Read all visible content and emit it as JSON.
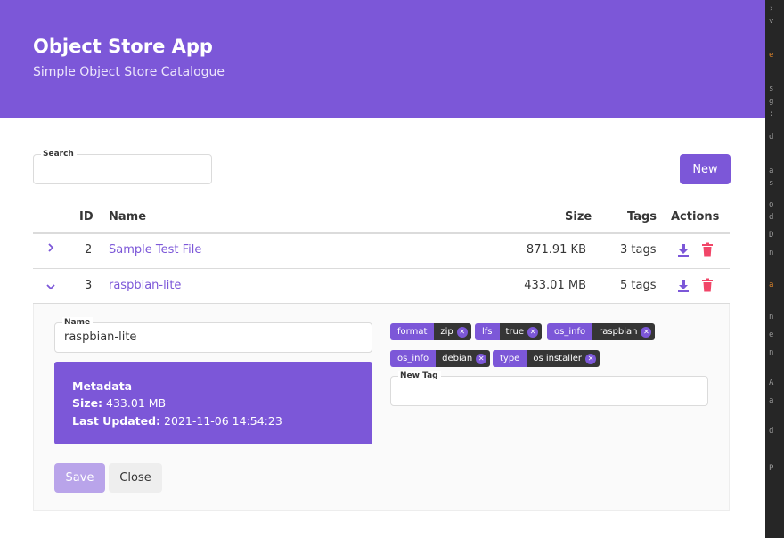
{
  "header": {
    "title": "Object Store App",
    "subtitle": "Simple Object Store Catalogue"
  },
  "search": {
    "label": "Search",
    "value": ""
  },
  "toolbar": {
    "new_label": "New"
  },
  "table": {
    "columns": {
      "id": "ID",
      "name": "Name",
      "size": "Size",
      "tags": "Tags",
      "actions": "Actions"
    },
    "rows": [
      {
        "id": "2",
        "name": "Sample Test File",
        "size": "871.91 KB",
        "tags": "3 tags",
        "expanded": false
      },
      {
        "id": "3",
        "name": "raspbian-lite",
        "size": "433.01 MB",
        "tags": "5 tags",
        "expanded": true
      }
    ]
  },
  "detail": {
    "name_label": "Name",
    "name_value": "raspbian-lite",
    "metadata_title": "Metadata",
    "size_label": "Size:",
    "size_value": "433.01 MB",
    "updated_label": "Last Updated:",
    "updated_value": "2021-11-06 14:54:23",
    "tags": [
      {
        "key": "format",
        "value": "zip"
      },
      {
        "key": "lfs",
        "value": "true"
      },
      {
        "key": "os_info",
        "value": "raspbian"
      },
      {
        "key": "os_info",
        "value": "debian"
      },
      {
        "key": "type",
        "value": "os installer"
      }
    ],
    "new_tag_label": "New Tag",
    "new_tag_value": "",
    "save_label": "Save",
    "close_label": "Close"
  },
  "colors": {
    "accent": "#7c57d8",
    "accent_disabled": "#b9a4ea",
    "danger": "#f14668",
    "tag_value_bg": "#363636"
  },
  "icons": {
    "expand": "chevron-right-icon",
    "collapse": "chevron-down-icon",
    "download": "download-icon",
    "delete": "trash-icon",
    "remove_tag": "close-circle-icon"
  }
}
